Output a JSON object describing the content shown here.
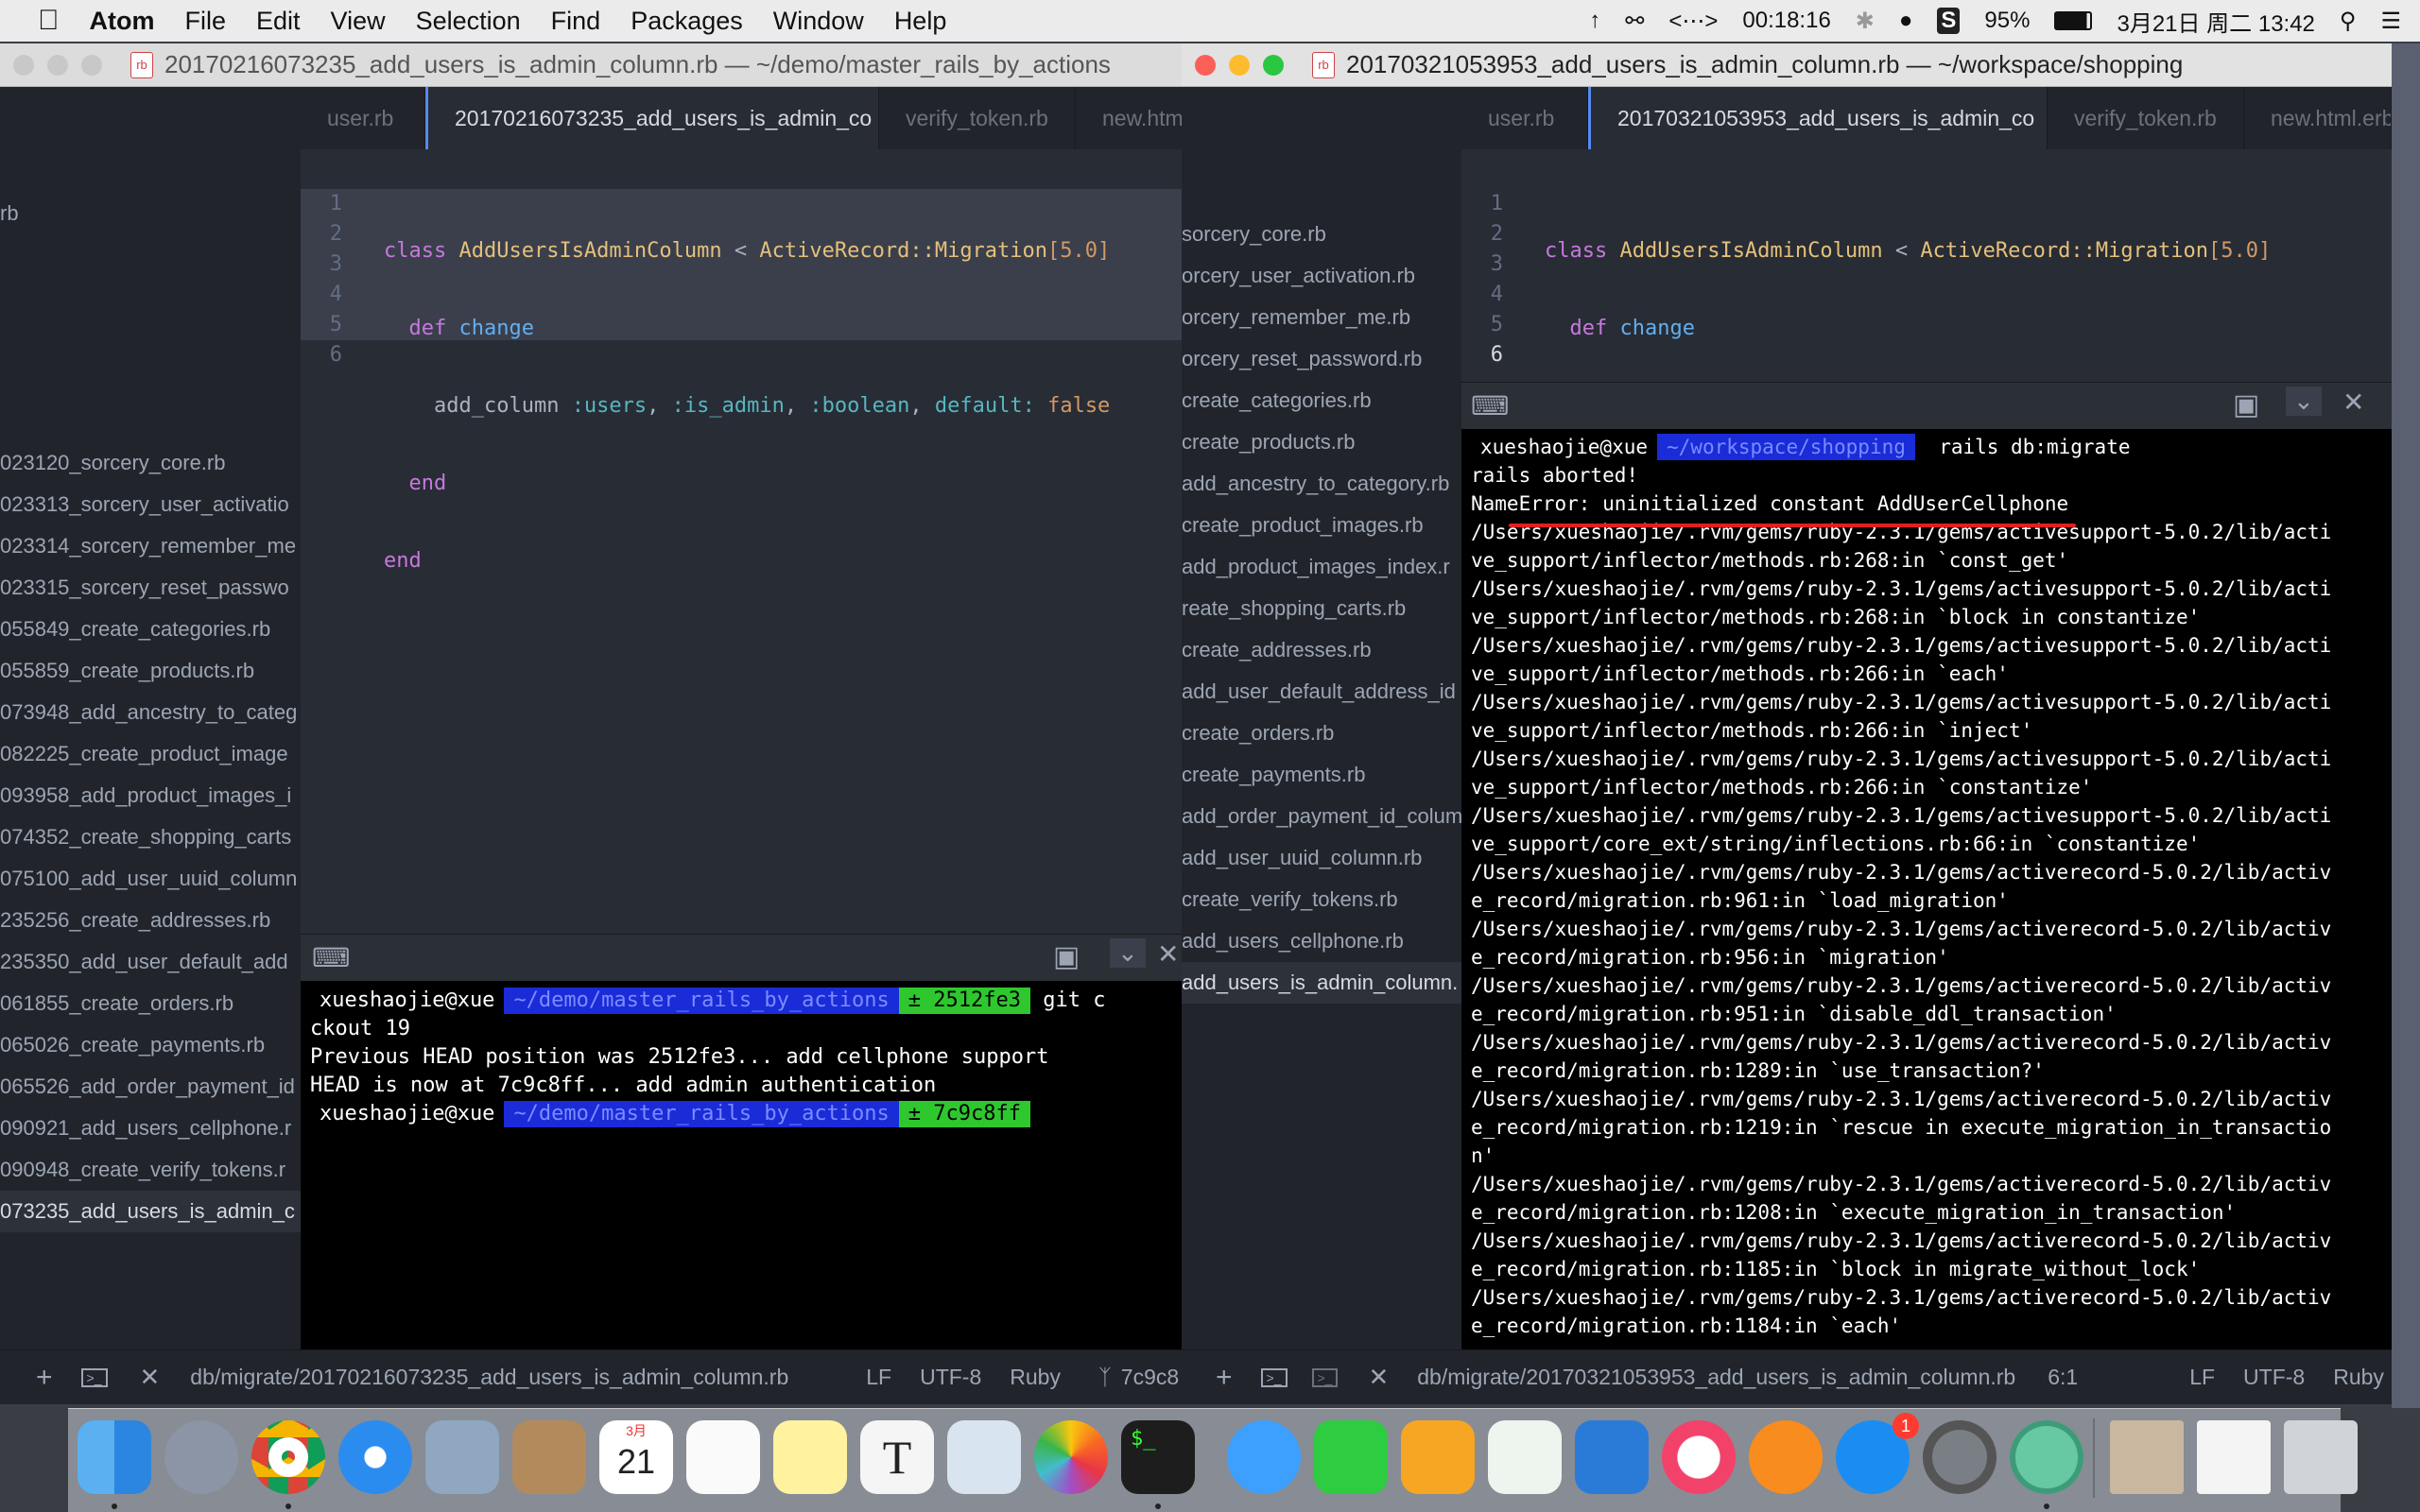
{
  "menubar": {
    "items": [
      "Atom",
      "File",
      "Edit",
      "View",
      "Selection",
      "Find",
      "Packages",
      "Window",
      "Help"
    ],
    "status": {
      "timer": "00:18:16",
      "battery": "95%",
      "datetime": "3月21日 周二  13:42"
    }
  },
  "left_window": {
    "title": "20170216073235_add_users_is_admin_column.rb — ~/demo/master_rails_by_actions",
    "tabs": [
      "user.rb",
      "20170216073235_add_users_is_admin_co",
      "verify_token.rb",
      "new.htm"
    ],
    "tree_items": [
      "rb",
      "023120_sorcery_core.rb",
      "023313_sorcery_user_activatio",
      "023314_sorcery_remember_me",
      "023315_sorcery_reset_passwo",
      "055849_create_categories.rb",
      "055859_create_products.rb",
      "073948_add_ancestry_to_categ",
      "082225_create_product_image",
      "093958_add_product_images_i",
      "074352_create_shopping_carts",
      "075100_add_user_uuid_column",
      "235256_create_addresses.rb",
      "235350_add_user_default_add",
      "061855_create_orders.rb",
      "065026_create_payments.rb",
      "065526_add_order_payment_id",
      "090921_add_users_cellphone.r",
      "090948_create_verify_tokens.r",
      "073235_add_users_is_admin_c"
    ],
    "line_numbers": [
      "1",
      "2",
      "3",
      "4",
      "5",
      "6"
    ],
    "terminal": {
      "user": "xueshaojie@xue",
      "path": "~/demo/master_rails_by_actions",
      "branch1": "± 2512fe3",
      "cmd_tail": "git c",
      "lines": [
        "ckout 19",
        "Previous HEAD position was 2512fe3... add cellphone support",
        "HEAD is now at 7c9c8ff... add admin authentication"
      ],
      "branch2": "± 7c9c8ff"
    },
    "status": {
      "path": "db/migrate/20170216073235_add_users_is_admin_column.rb",
      "lf": "LF",
      "enc": "UTF-8",
      "lang": "Ruby",
      "git": "7c9c8"
    }
  },
  "right_window": {
    "title": "20170321053953_add_users_is_admin_column.rb — ~/workspace/shopping",
    "tabs": [
      "user.rb",
      "20170321053953_add_users_is_admin_co",
      "verify_token.rb",
      "new.html.erb"
    ],
    "tree_items": [
      "sorcery_core.rb",
      "orcery_user_activation.rb",
      "orcery_remember_me.rb",
      "orcery_reset_password.rb",
      "create_categories.rb",
      "create_products.rb",
      "add_ancestry_to_category.rb",
      "create_product_images.rb",
      "add_product_images_index.r",
      "reate_shopping_carts.rb",
      "create_addresses.rb",
      "add_user_default_address_id",
      "create_orders.rb",
      "create_payments.rb",
      "add_order_payment_id_colum",
      "add_user_uuid_column.rb",
      "create_verify_tokens.rb",
      "add_users_cellphone.rb",
      "add_users_is_admin_column."
    ],
    "line_numbers": [
      "1",
      "2",
      "3",
      "4",
      "5",
      "6"
    ],
    "terminal": {
      "user": "xueshaojie@xue",
      "path": "~/workspace/shopping",
      "cmd": "rails db:migrate",
      "lines": [
        "rails aborted!",
        "NameError: uninitialized constant AddUserCellphone",
        "/Users/xueshaojie/.rvm/gems/ruby-2.3.1/gems/activesupport-5.0.2/lib/acti",
        "ve_support/inflector/methods.rb:268:in `const_get'",
        "/Users/xueshaojie/.rvm/gems/ruby-2.3.1/gems/activesupport-5.0.2/lib/acti",
        "ve_support/inflector/methods.rb:268:in `block in constantize'",
        "/Users/xueshaojie/.rvm/gems/ruby-2.3.1/gems/activesupport-5.0.2/lib/acti",
        "ve_support/inflector/methods.rb:266:in `each'",
        "/Users/xueshaojie/.rvm/gems/ruby-2.3.1/gems/activesupport-5.0.2/lib/acti",
        "ve_support/inflector/methods.rb:266:in `inject'",
        "/Users/xueshaojie/.rvm/gems/ruby-2.3.1/gems/activesupport-5.0.2/lib/acti",
        "ve_support/inflector/methods.rb:266:in `constantize'",
        "/Users/xueshaojie/.rvm/gems/ruby-2.3.1/gems/activesupport-5.0.2/lib/acti",
        "ve_support/core_ext/string/inflections.rb:66:in `constantize'",
        "/Users/xueshaojie/.rvm/gems/ruby-2.3.1/gems/activerecord-5.0.2/lib/activ",
        "e_record/migration.rb:961:in `load_migration'",
        "/Users/xueshaojie/.rvm/gems/ruby-2.3.1/gems/activerecord-5.0.2/lib/activ",
        "e_record/migration.rb:956:in `migration'",
        "/Users/xueshaojie/.rvm/gems/ruby-2.3.1/gems/activerecord-5.0.2/lib/activ",
        "e_record/migration.rb:951:in `disable_ddl_transaction'",
        "/Users/xueshaojie/.rvm/gems/ruby-2.3.1/gems/activerecord-5.0.2/lib/activ",
        "e_record/migration.rb:1289:in `use_transaction?'",
        "/Users/xueshaojie/.rvm/gems/ruby-2.3.1/gems/activerecord-5.0.2/lib/activ",
        "e_record/migration.rb:1219:in `rescue in execute_migration_in_transactio",
        "n'",
        "/Users/xueshaojie/.rvm/gems/ruby-2.3.1/gems/activerecord-5.0.2/lib/activ",
        "e_record/migration.rb:1208:in `execute_migration_in_transaction'",
        "/Users/xueshaojie/.rvm/gems/ruby-2.3.1/gems/activerecord-5.0.2/lib/activ",
        "e_record/migration.rb:1185:in `block in migrate_without_lock'",
        "/Users/xueshaojie/.rvm/gems/ruby-2.3.1/gems/activerecord-5.0.2/lib/activ",
        "e_record/migration.rb:1184:in `each'"
      ]
    },
    "status": {
      "path": "db/migrate/20170321053953_add_users_is_admin_column.rb",
      "pos": "6:1",
      "lf": "LF",
      "enc": "UTF-8",
      "lang": "Ruby"
    }
  },
  "code": {
    "l1": {
      "kw": "class",
      "name": "AddUsersIsAdminColumn",
      "op": " < ",
      "parent": "ActiveRecord::Migration",
      "ver": "[5.0]"
    },
    "l2": {
      "kw": "def",
      "name": "change"
    },
    "l3": {
      "call": "add_column ",
      "a1": ":users",
      "a2": ":is_admin",
      "a3": ":boolean",
      "key": "default:",
      "val": "false",
      "sep": ", "
    },
    "l4": "end",
    "l5": "end"
  },
  "dock": {
    "calendar_month": "3月",
    "calendar_day": "21",
    "appstore_badge": "1",
    "terminal_glyph": "$_",
    "textedit_glyph": "T"
  }
}
